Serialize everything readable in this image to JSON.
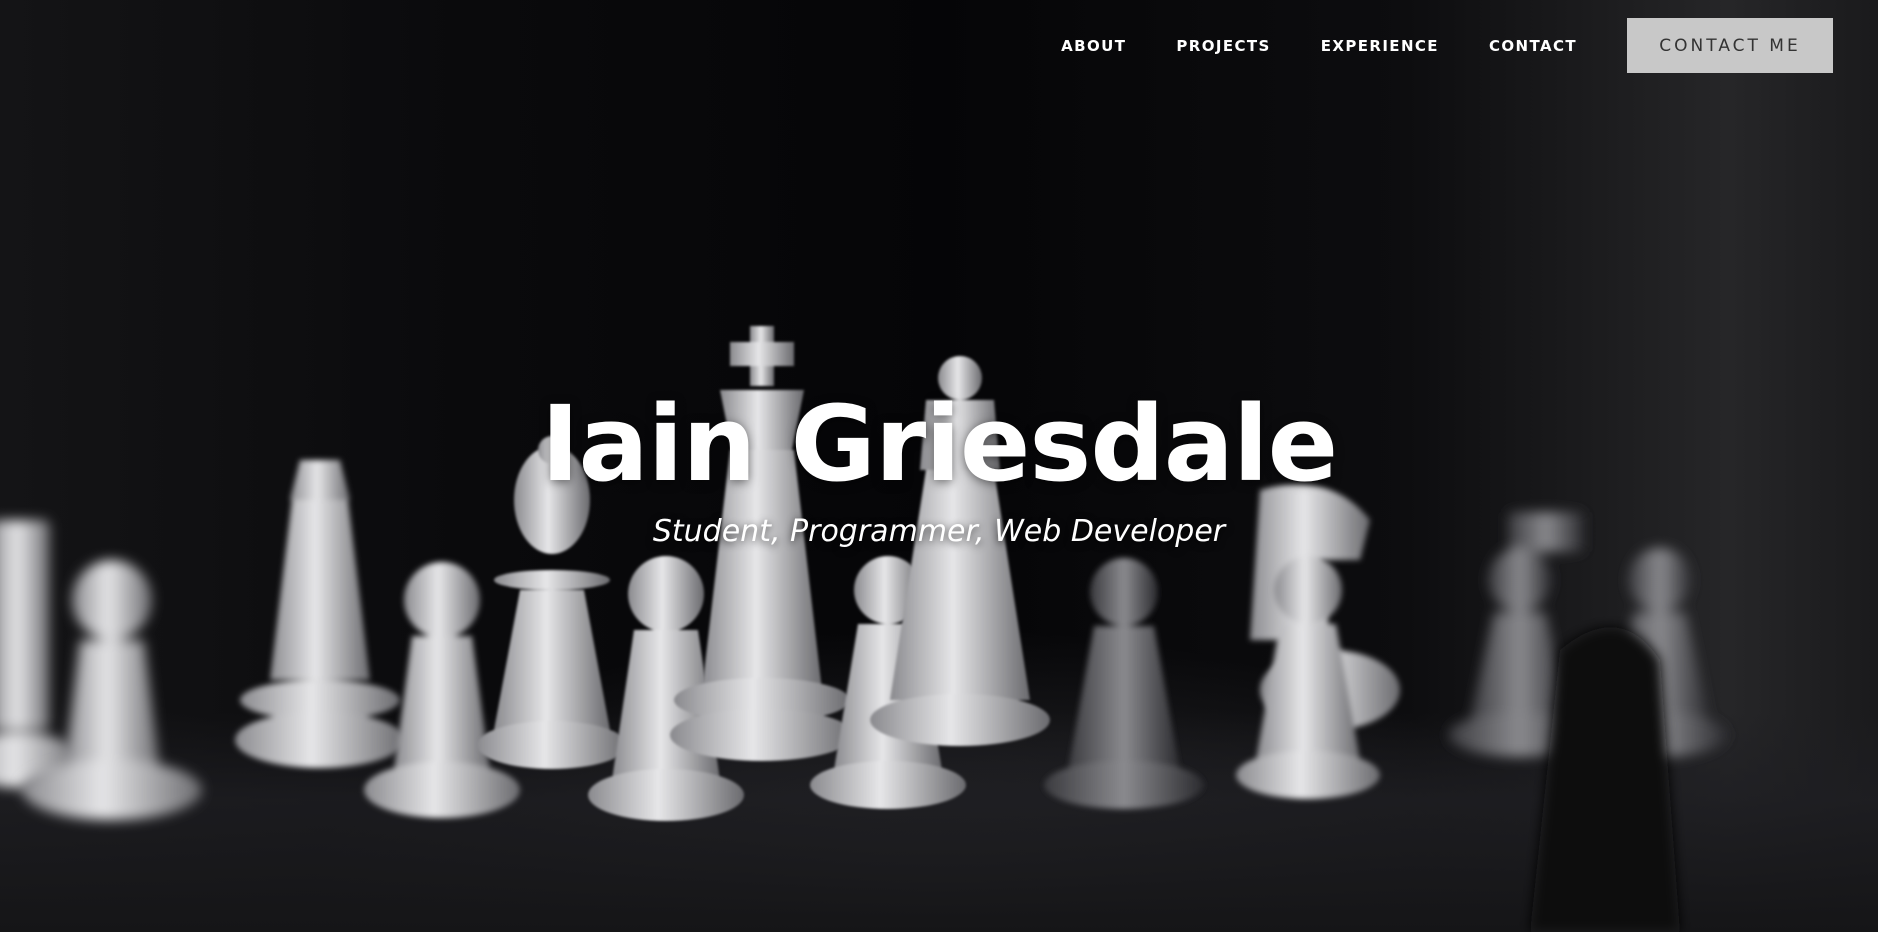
{
  "nav": {
    "items": [
      {
        "label": "ABOUT"
      },
      {
        "label": "PROJECTS"
      },
      {
        "label": "EXPERIENCE"
      },
      {
        "label": "CONTACT"
      }
    ],
    "cta_label": "CONTACT ME"
  },
  "hero": {
    "title": "Iain Griesdale",
    "subtitle": "Student, Programmer, Web Developer",
    "background": "chess-pieces-photo"
  },
  "colors": {
    "background": "#050507",
    "text": "#ffffff",
    "cta_background": "#c8c8c8",
    "cta_text": "#333333"
  }
}
